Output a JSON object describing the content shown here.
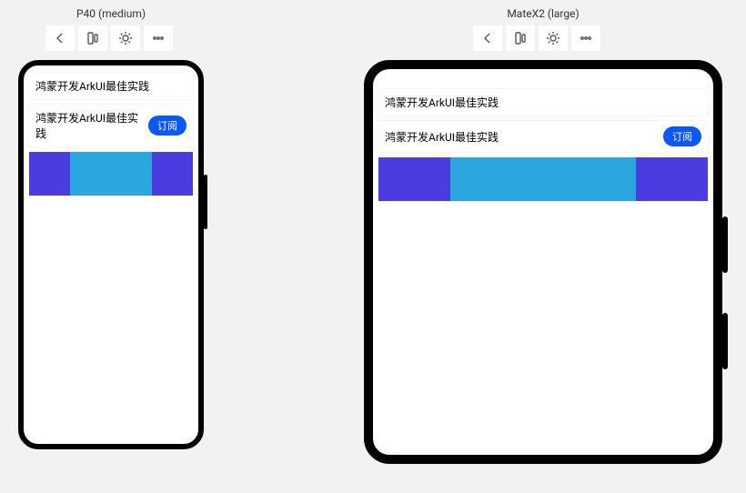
{
  "devices": {
    "p40": {
      "label": "P40 (medium)"
    },
    "matex2": {
      "label": "MateX2 (large)"
    }
  },
  "content": {
    "row1_text": "鸿蒙开发ArkUI最佳实践",
    "row2_text": "鸿蒙开发ArkUI最佳实践",
    "subscribe_label": "订阅"
  },
  "bars": {
    "segments": [
      {
        "color": "dark",
        "flex": 1
      },
      {
        "color": "light",
        "flex": 2
      },
      {
        "color": "dark",
        "flex": 1
      }
    ]
  },
  "colors": {
    "bar_dark": "#4b3ce0",
    "bar_light": "#2ca6df",
    "pill": "#0a59f7"
  },
  "toolbar": {
    "back_icon": "back-icon",
    "layout_icon": "layout-icon",
    "sun_icon": "sun-icon",
    "more_icon": "more-icon"
  }
}
